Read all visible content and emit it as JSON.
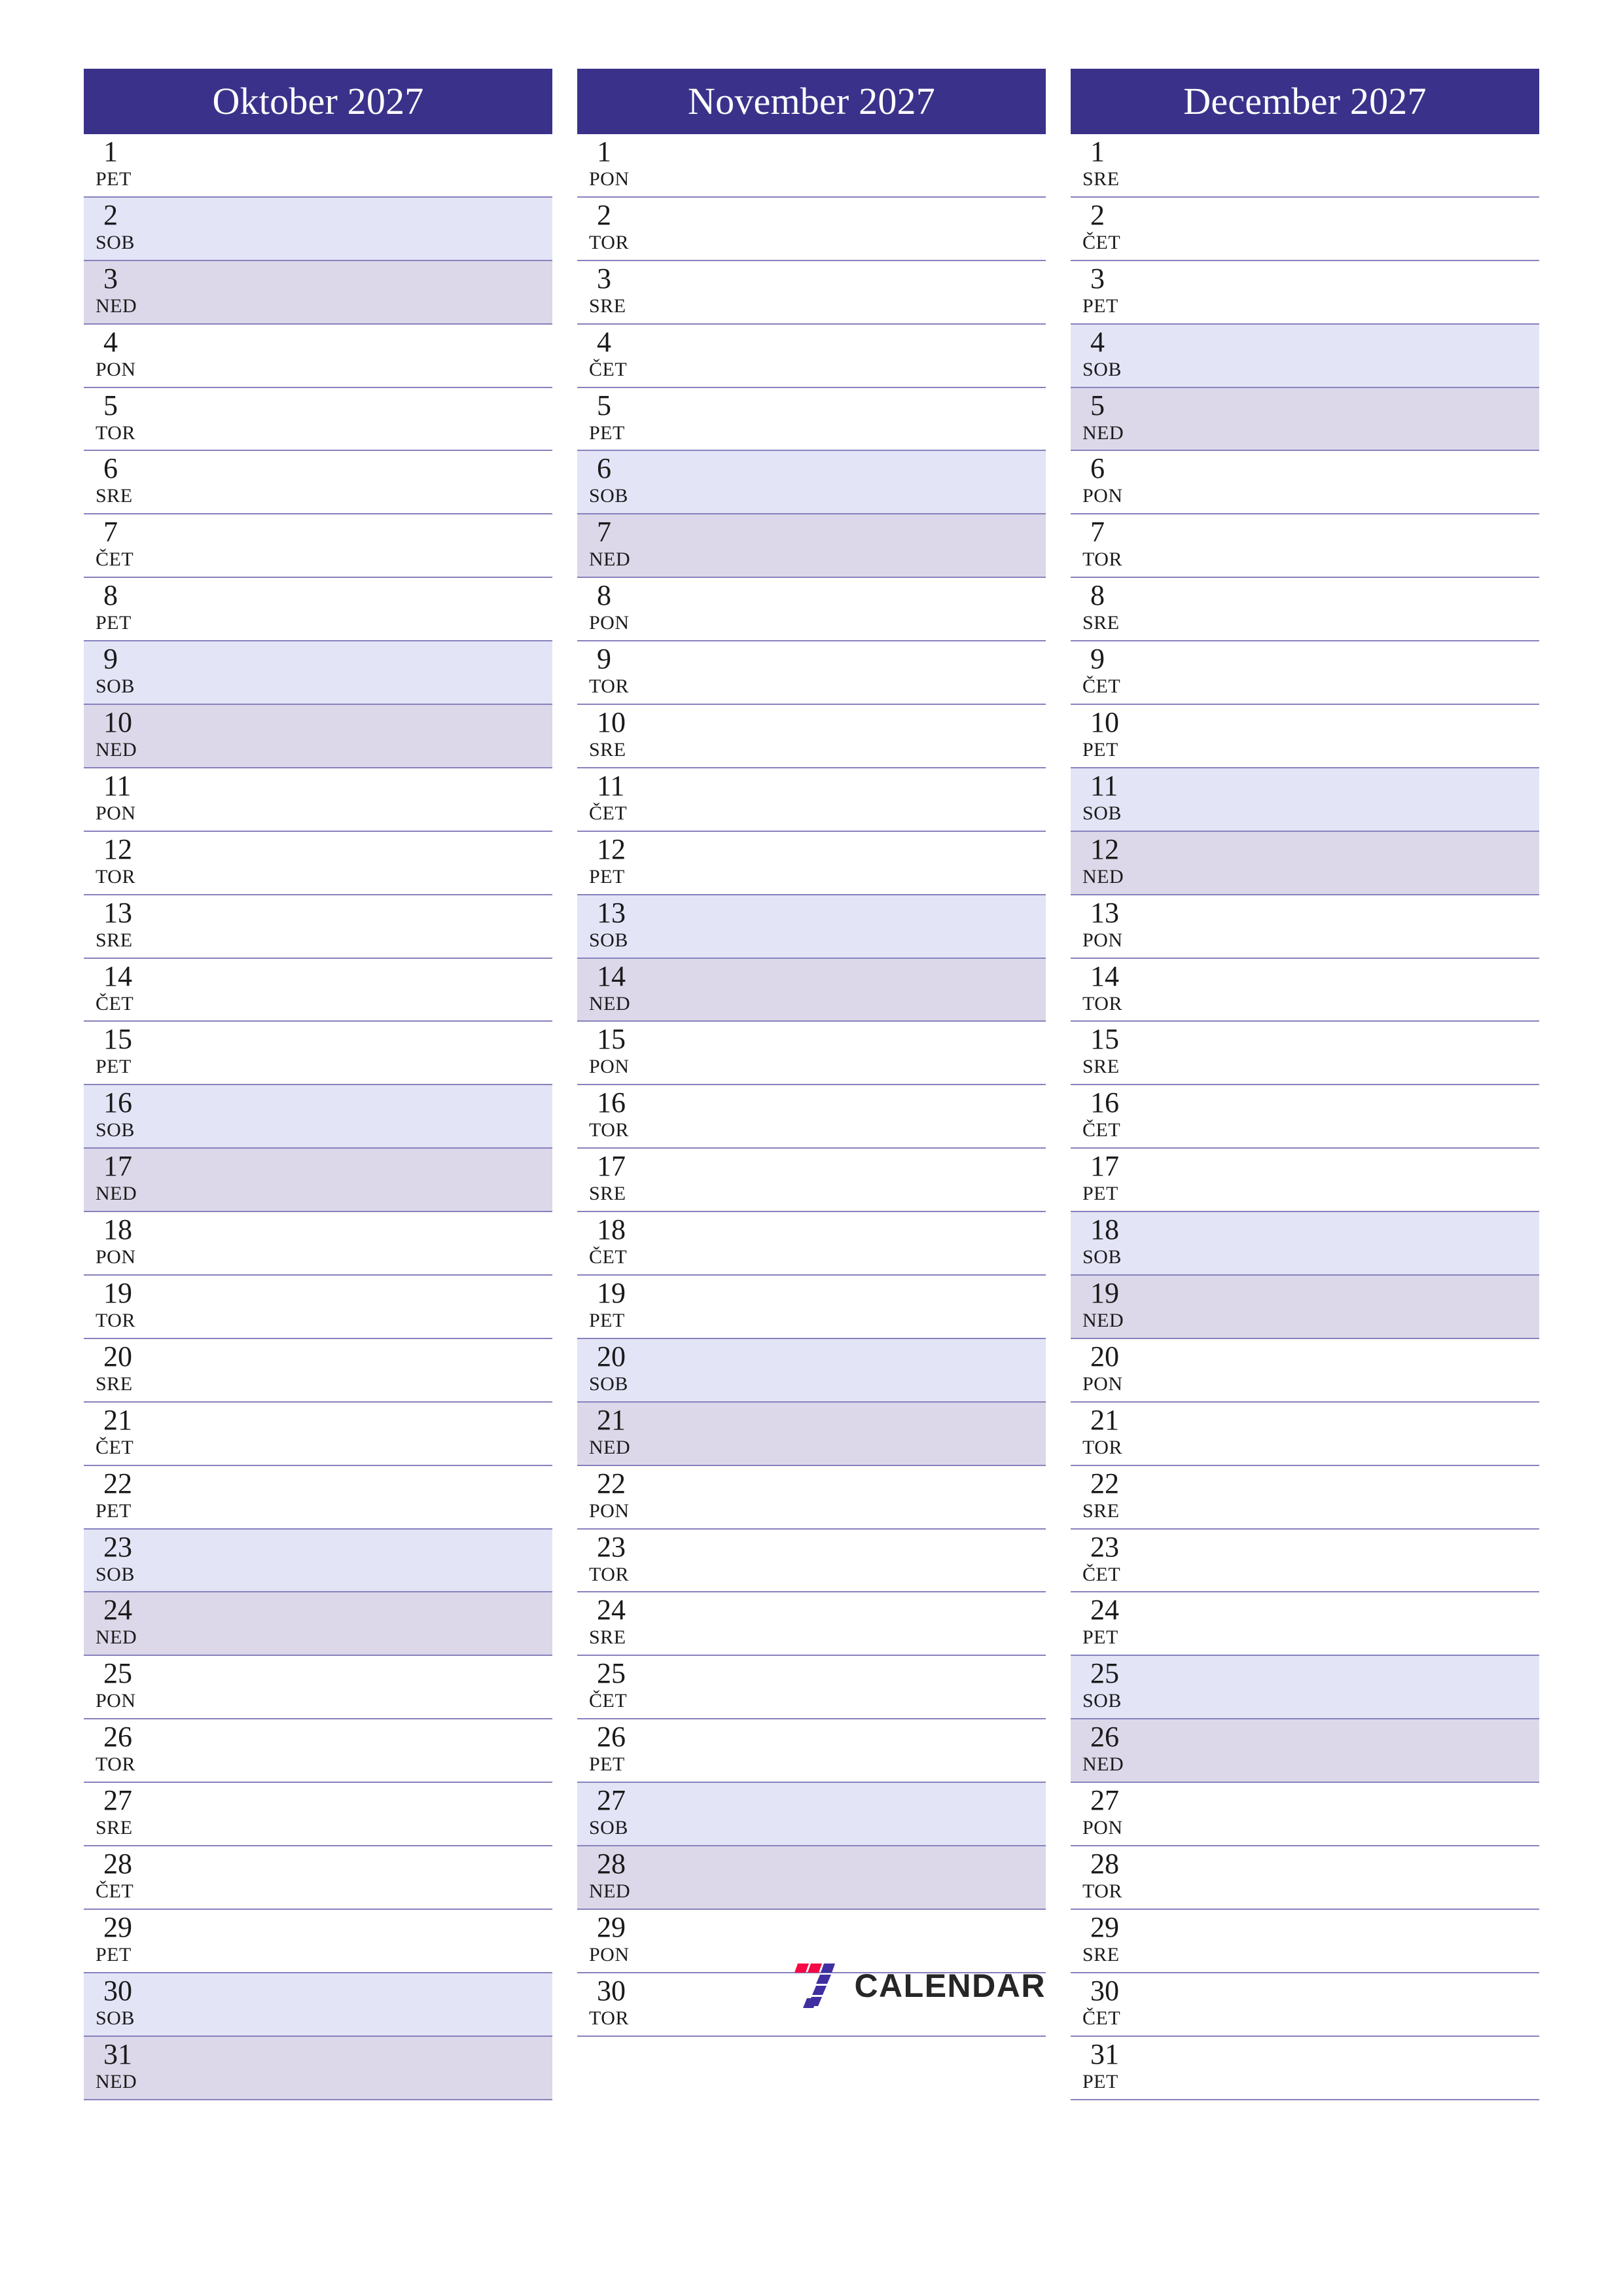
{
  "colors": {
    "header_bg": "#3a328a",
    "header_text": "#ffffff",
    "saturday_bg": "#e3e4f6",
    "sunday_bg": "#dcd8e9",
    "row_border": "#8782bd",
    "day_text": "#1a1a1a",
    "logo_red": "#f50a46",
    "logo_purple": "#3f2fa0",
    "logo_word": "#262626"
  },
  "logo": {
    "mark_name": "seven-calendar-logo-icon",
    "word": "CALENDAR"
  },
  "months": [
    {
      "title": "Oktober 2027",
      "days": [
        {
          "num": "1",
          "dow": "PET",
          "type": "weekday"
        },
        {
          "num": "2",
          "dow": "SOB",
          "type": "sat"
        },
        {
          "num": "3",
          "dow": "NED",
          "type": "sun"
        },
        {
          "num": "4",
          "dow": "PON",
          "type": "weekday"
        },
        {
          "num": "5",
          "dow": "TOR",
          "type": "weekday"
        },
        {
          "num": "6",
          "dow": "SRE",
          "type": "weekday"
        },
        {
          "num": "7",
          "dow": "ČET",
          "type": "weekday"
        },
        {
          "num": "8",
          "dow": "PET",
          "type": "weekday"
        },
        {
          "num": "9",
          "dow": "SOB",
          "type": "sat"
        },
        {
          "num": "10",
          "dow": "NED",
          "type": "sun"
        },
        {
          "num": "11",
          "dow": "PON",
          "type": "weekday"
        },
        {
          "num": "12",
          "dow": "TOR",
          "type": "weekday"
        },
        {
          "num": "13",
          "dow": "SRE",
          "type": "weekday"
        },
        {
          "num": "14",
          "dow": "ČET",
          "type": "weekday"
        },
        {
          "num": "15",
          "dow": "PET",
          "type": "weekday"
        },
        {
          "num": "16",
          "dow": "SOB",
          "type": "sat"
        },
        {
          "num": "17",
          "dow": "NED",
          "type": "sun"
        },
        {
          "num": "18",
          "dow": "PON",
          "type": "weekday"
        },
        {
          "num": "19",
          "dow": "TOR",
          "type": "weekday"
        },
        {
          "num": "20",
          "dow": "SRE",
          "type": "weekday"
        },
        {
          "num": "21",
          "dow": "ČET",
          "type": "weekday"
        },
        {
          "num": "22",
          "dow": "PET",
          "type": "weekday"
        },
        {
          "num": "23",
          "dow": "SOB",
          "type": "sat"
        },
        {
          "num": "24",
          "dow": "NED",
          "type": "sun"
        },
        {
          "num": "25",
          "dow": "PON",
          "type": "weekday"
        },
        {
          "num": "26",
          "dow": "TOR",
          "type": "weekday"
        },
        {
          "num": "27",
          "dow": "SRE",
          "type": "weekday"
        },
        {
          "num": "28",
          "dow": "ČET",
          "type": "weekday"
        },
        {
          "num": "29",
          "dow": "PET",
          "type": "weekday"
        },
        {
          "num": "30",
          "dow": "SOB",
          "type": "sat"
        },
        {
          "num": "31",
          "dow": "NED",
          "type": "sun"
        }
      ]
    },
    {
      "title": "November 2027",
      "days": [
        {
          "num": "1",
          "dow": "PON",
          "type": "weekday"
        },
        {
          "num": "2",
          "dow": "TOR",
          "type": "weekday"
        },
        {
          "num": "3",
          "dow": "SRE",
          "type": "weekday"
        },
        {
          "num": "4",
          "dow": "ČET",
          "type": "weekday"
        },
        {
          "num": "5",
          "dow": "PET",
          "type": "weekday"
        },
        {
          "num": "6",
          "dow": "SOB",
          "type": "sat"
        },
        {
          "num": "7",
          "dow": "NED",
          "type": "sun"
        },
        {
          "num": "8",
          "dow": "PON",
          "type": "weekday"
        },
        {
          "num": "9",
          "dow": "TOR",
          "type": "weekday"
        },
        {
          "num": "10",
          "dow": "SRE",
          "type": "weekday"
        },
        {
          "num": "11",
          "dow": "ČET",
          "type": "weekday"
        },
        {
          "num": "12",
          "dow": "PET",
          "type": "weekday"
        },
        {
          "num": "13",
          "dow": "SOB",
          "type": "sat"
        },
        {
          "num": "14",
          "dow": "NED",
          "type": "sun"
        },
        {
          "num": "15",
          "dow": "PON",
          "type": "weekday"
        },
        {
          "num": "16",
          "dow": "TOR",
          "type": "weekday"
        },
        {
          "num": "17",
          "dow": "SRE",
          "type": "weekday"
        },
        {
          "num": "18",
          "dow": "ČET",
          "type": "weekday"
        },
        {
          "num": "19",
          "dow": "PET",
          "type": "weekday"
        },
        {
          "num": "20",
          "dow": "SOB",
          "type": "sat"
        },
        {
          "num": "21",
          "dow": "NED",
          "type": "sun"
        },
        {
          "num": "22",
          "dow": "PON",
          "type": "weekday"
        },
        {
          "num": "23",
          "dow": "TOR",
          "type": "weekday"
        },
        {
          "num": "24",
          "dow": "SRE",
          "type": "weekday"
        },
        {
          "num": "25",
          "dow": "ČET",
          "type": "weekday"
        },
        {
          "num": "26",
          "dow": "PET",
          "type": "weekday"
        },
        {
          "num": "27",
          "dow": "SOB",
          "type": "sat"
        },
        {
          "num": "28",
          "dow": "NED",
          "type": "sun"
        },
        {
          "num": "29",
          "dow": "PON",
          "type": "weekday"
        },
        {
          "num": "30",
          "dow": "TOR",
          "type": "weekday"
        }
      ]
    },
    {
      "title": "December 2027",
      "days": [
        {
          "num": "1",
          "dow": "SRE",
          "type": "weekday"
        },
        {
          "num": "2",
          "dow": "ČET",
          "type": "weekday"
        },
        {
          "num": "3",
          "dow": "PET",
          "type": "weekday"
        },
        {
          "num": "4",
          "dow": "SOB",
          "type": "sat"
        },
        {
          "num": "5",
          "dow": "NED",
          "type": "sun"
        },
        {
          "num": "6",
          "dow": "PON",
          "type": "weekday"
        },
        {
          "num": "7",
          "dow": "TOR",
          "type": "weekday"
        },
        {
          "num": "8",
          "dow": "SRE",
          "type": "weekday"
        },
        {
          "num": "9",
          "dow": "ČET",
          "type": "weekday"
        },
        {
          "num": "10",
          "dow": "PET",
          "type": "weekday"
        },
        {
          "num": "11",
          "dow": "SOB",
          "type": "sat"
        },
        {
          "num": "12",
          "dow": "NED",
          "type": "sun"
        },
        {
          "num": "13",
          "dow": "PON",
          "type": "weekday"
        },
        {
          "num": "14",
          "dow": "TOR",
          "type": "weekday"
        },
        {
          "num": "15",
          "dow": "SRE",
          "type": "weekday"
        },
        {
          "num": "16",
          "dow": "ČET",
          "type": "weekday"
        },
        {
          "num": "17",
          "dow": "PET",
          "type": "weekday"
        },
        {
          "num": "18",
          "dow": "SOB",
          "type": "sat"
        },
        {
          "num": "19",
          "dow": "NED",
          "type": "sun"
        },
        {
          "num": "20",
          "dow": "PON",
          "type": "weekday"
        },
        {
          "num": "21",
          "dow": "TOR",
          "type": "weekday"
        },
        {
          "num": "22",
          "dow": "SRE",
          "type": "weekday"
        },
        {
          "num": "23",
          "dow": "ČET",
          "type": "weekday"
        },
        {
          "num": "24",
          "dow": "PET",
          "type": "weekday"
        },
        {
          "num": "25",
          "dow": "SOB",
          "type": "sat"
        },
        {
          "num": "26",
          "dow": "NED",
          "type": "sun"
        },
        {
          "num": "27",
          "dow": "PON",
          "type": "weekday"
        },
        {
          "num": "28",
          "dow": "TOR",
          "type": "weekday"
        },
        {
          "num": "29",
          "dow": "SRE",
          "type": "weekday"
        },
        {
          "num": "30",
          "dow": "ČET",
          "type": "weekday"
        },
        {
          "num": "31",
          "dow": "PET",
          "type": "weekday"
        }
      ]
    }
  ]
}
